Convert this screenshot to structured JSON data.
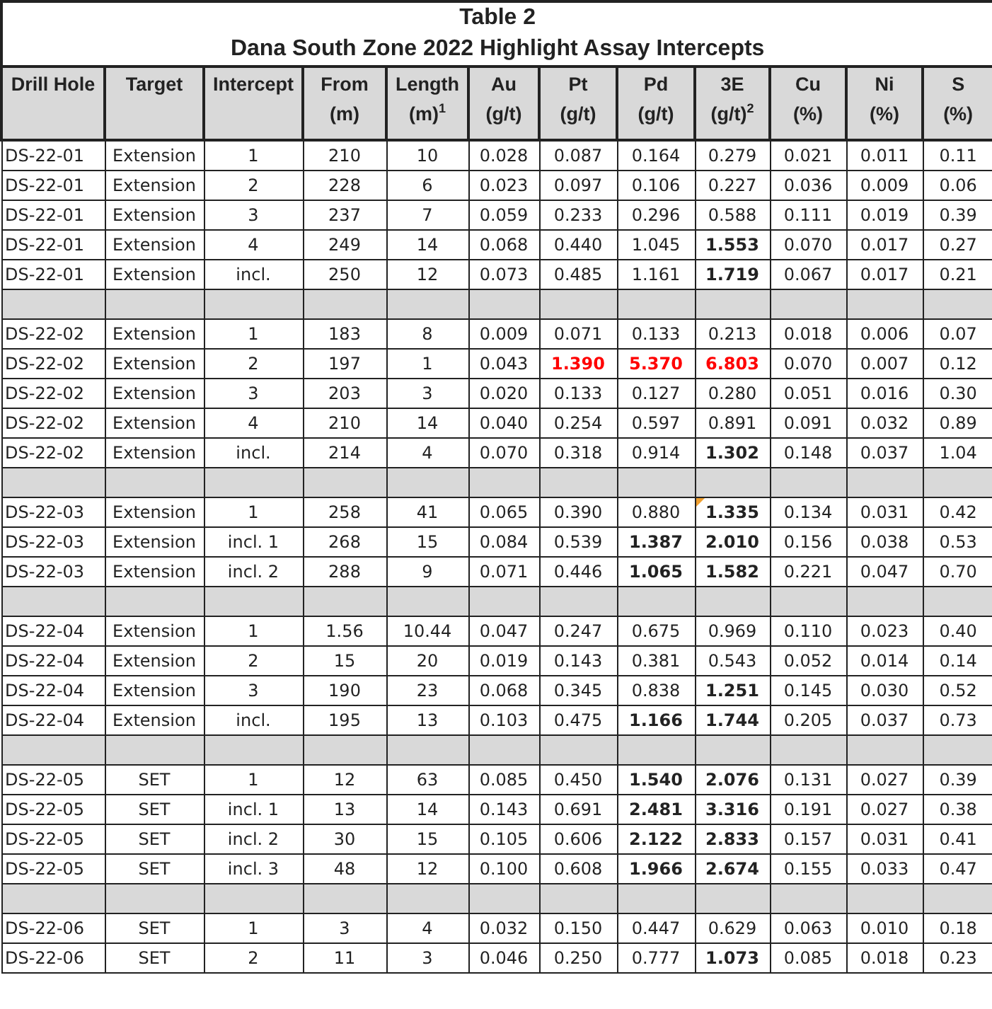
{
  "title": {
    "heading": "Table 2",
    "subheading": "Dana South Zone 2022 Highlight Assay Intercepts"
  },
  "columns": [
    {
      "title": "Drill Hole"
    },
    {
      "title": "Target"
    },
    {
      "title": "Intercept"
    },
    {
      "title": "From",
      "unit": "(m)"
    },
    {
      "title": "Length",
      "unit": "(m)$^{1}$"
    },
    {
      "title": "Au",
      "unit": "(g/t)"
    },
    {
      "title": "Pt",
      "unit": "(g/t)"
    },
    {
      "title": "Pd",
      "unit": "(g/t)"
    },
    {
      "title": "3E",
      "unit": "(g/t)$^{2}$"
    },
    {
      "title": "Cu",
      "unit": "(%)"
    },
    {
      "title": "Ni",
      "unit": "(%)"
    },
    {
      "title": "S",
      "unit": "(%)"
    }
  ],
  "rows": [
    {
      "kind": "data",
      "cells": [
        "DS-22-01",
        "Extension",
        "1",
        "210",
        "10",
        "0.028",
        "0.087",
        "0.164",
        "0.279",
        "0.021",
        "0.011",
        "0.11"
      ]
    },
    {
      "kind": "data",
      "cells": [
        "DS-22-01",
        "Extension",
        "2",
        "228",
        "6",
        "0.023",
        "0.097",
        "0.106",
        "0.227",
        "0.036",
        "0.009",
        "0.06"
      ]
    },
    {
      "kind": "data",
      "cells": [
        "DS-22-01",
        "Extension",
        "3",
        "237",
        "7",
        "0.059",
        "0.233",
        "0.296",
        "0.588",
        "0.111",
        "0.019",
        "0.39"
      ]
    },
    {
      "kind": "data",
      "cells": [
        "DS-22-01",
        "Extension",
        "4",
        "249",
        "14",
        "0.068",
        "0.440",
        "1.045",
        {
          "text": "1.553",
          "bold": true
        },
        "0.070",
        "0.017",
        "0.27"
      ]
    },
    {
      "kind": "data",
      "cells": [
        "DS-22-01",
        "Extension",
        "incl.",
        "250",
        "12",
        "0.073",
        "0.485",
        "1.161",
        {
          "text": "1.719",
          "bold": true
        },
        "0.067",
        "0.017",
        "0.21"
      ]
    },
    {
      "kind": "spacer"
    },
    {
      "kind": "data",
      "cells": [
        "DS-22-02",
        "Extension",
        "1",
        "183",
        "8",
        "0.009",
        "0.071",
        "0.133",
        "0.213",
        "0.018",
        "0.006",
        "0.07"
      ]
    },
    {
      "kind": "data",
      "cells": [
        "DS-22-02",
        "Extension",
        "2",
        "197",
        "1",
        "0.043",
        {
          "text": "1.390",
          "bold": true,
          "red": true
        },
        {
          "text": "5.370",
          "bold": true,
          "red": true
        },
        {
          "text": "6.803",
          "bold": true,
          "red": true
        },
        "0.070",
        "0.007",
        "0.12"
      ]
    },
    {
      "kind": "data",
      "cells": [
        "DS-22-02",
        "Extension",
        "3",
        "203",
        "3",
        "0.020",
        "0.133",
        "0.127",
        "0.280",
        "0.051",
        "0.016",
        "0.30"
      ]
    },
    {
      "kind": "data",
      "cells": [
        "DS-22-02",
        "Extension",
        "4",
        "210",
        "14",
        "0.040",
        "0.254",
        "0.597",
        "0.891",
        "0.091",
        "0.032",
        "0.89"
      ]
    },
    {
      "kind": "data",
      "cells": [
        "DS-22-02",
        "Extension",
        "incl.",
        "214",
        "4",
        "0.070",
        "0.318",
        "0.914",
        {
          "text": "1.302",
          "bold": true
        },
        "0.148",
        "0.037",
        "1.04"
      ]
    },
    {
      "kind": "spacer"
    },
    {
      "kind": "data",
      "cells": [
        "DS-22-03",
        "Extension",
        "1",
        "258",
        "41",
        "0.065",
        "0.390",
        "0.880",
        {
          "text": "1.335",
          "bold": true,
          "comment": true
        },
        "0.134",
        "0.031",
        "0.42"
      ]
    },
    {
      "kind": "data",
      "cells": [
        "DS-22-03",
        "Extension",
        "incl. 1",
        "268",
        "15",
        "0.084",
        "0.539",
        {
          "text": "1.387",
          "bold": true
        },
        {
          "text": "2.010",
          "bold": true
        },
        "0.156",
        "0.038",
        "0.53"
      ]
    },
    {
      "kind": "data",
      "cells": [
        "DS-22-03",
        "Extension",
        "incl. 2",
        "288",
        "9",
        "0.071",
        "0.446",
        {
          "text": "1.065",
          "bold": true
        },
        {
          "text": "1.582",
          "bold": true
        },
        "0.221",
        "0.047",
        "0.70"
      ]
    },
    {
      "kind": "spacer"
    },
    {
      "kind": "data",
      "cells": [
        "DS-22-04",
        "Extension",
        "1",
        "1.56",
        "10.44",
        "0.047",
        "0.247",
        "0.675",
        "0.969",
        "0.110",
        "0.023",
        "0.40"
      ]
    },
    {
      "kind": "data",
      "cells": [
        "DS-22-04",
        "Extension",
        "2",
        "15",
        "20",
        "0.019",
        "0.143",
        "0.381",
        "0.543",
        "0.052",
        "0.014",
        "0.14"
      ]
    },
    {
      "kind": "data",
      "cells": [
        "DS-22-04",
        "Extension",
        "3",
        "190",
        "23",
        "0.068",
        "0.345",
        "0.838",
        {
          "text": "1.251",
          "bold": true
        },
        "0.145",
        "0.030",
        "0.52"
      ]
    },
    {
      "kind": "data",
      "cells": [
        "DS-22-04",
        "Extension",
        "incl.",
        "195",
        "13",
        "0.103",
        "0.475",
        {
          "text": "1.166",
          "bold": true
        },
        {
          "text": "1.744",
          "bold": true
        },
        "0.205",
        "0.037",
        "0.73"
      ]
    },
    {
      "kind": "spacer"
    },
    {
      "kind": "data",
      "cells": [
        "DS-22-05",
        "SET",
        "1",
        "12",
        "63",
        "0.085",
        "0.450",
        {
          "text": "1.540",
          "bold": true
        },
        {
          "text": "2.076",
          "bold": true
        },
        "0.131",
        "0.027",
        "0.39"
      ]
    },
    {
      "kind": "data",
      "cells": [
        "DS-22-05",
        "SET",
        "incl. 1",
        "13",
        "14",
        "0.143",
        "0.691",
        {
          "text": "2.481",
          "bold": true
        },
        {
          "text": "3.316",
          "bold": true
        },
        "0.191",
        "0.027",
        "0.38"
      ]
    },
    {
      "kind": "data",
      "cells": [
        "DS-22-05",
        "SET",
        "incl. 2",
        "30",
        "15",
        "0.105",
        "0.606",
        {
          "text": "2.122",
          "bold": true
        },
        {
          "text": "2.833",
          "bold": true
        },
        "0.157",
        "0.031",
        "0.41"
      ]
    },
    {
      "kind": "data",
      "cells": [
        "DS-22-05",
        "SET",
        "incl. 3",
        "48",
        "12",
        "0.100",
        "0.608",
        {
          "text": "1.966",
          "bold": true
        },
        {
          "text": "2.674",
          "bold": true
        },
        "0.155",
        "0.033",
        "0.47"
      ]
    },
    {
      "kind": "spacer"
    },
    {
      "kind": "data",
      "cells": [
        "DS-22-06",
        "SET",
        "1",
        "3",
        "4",
        "0.032",
        "0.150",
        "0.447",
        "0.629",
        "0.063",
        "0.010",
        "0.18"
      ]
    },
    {
      "kind": "data",
      "cells": [
        "DS-22-06",
        "SET",
        "2",
        "11",
        "3",
        "0.046",
        "0.250",
        "0.777",
        {
          "text": "1.073",
          "bold": true
        },
        "0.085",
        "0.018",
        "0.23"
      ]
    }
  ]
}
